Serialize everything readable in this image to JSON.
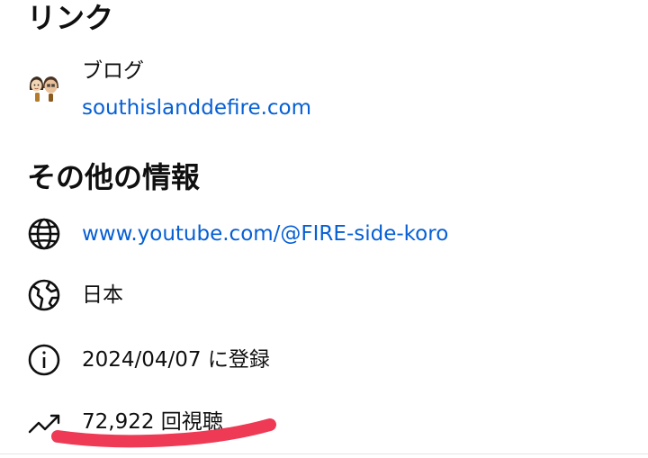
{
  "links": {
    "heading": "リンク",
    "items": [
      {
        "title": "ブログ",
        "url": "southislanddefire.com"
      }
    ]
  },
  "info": {
    "heading": "その他の情報",
    "channel_url": "www.youtube.com/@FIRE-side-koro",
    "country": "日本",
    "joined": "2024/04/07 に登録",
    "views": "72,922 回視聴"
  },
  "icons": {
    "blog": "blog-avatar-icon",
    "channel": "globe-icon",
    "country": "earth-region-icon",
    "joined": "info-icon",
    "views": "trending-up-icon"
  },
  "colors": {
    "link": "#065fd4",
    "text": "#0f0f0f",
    "highlight": "#ee3a55"
  }
}
